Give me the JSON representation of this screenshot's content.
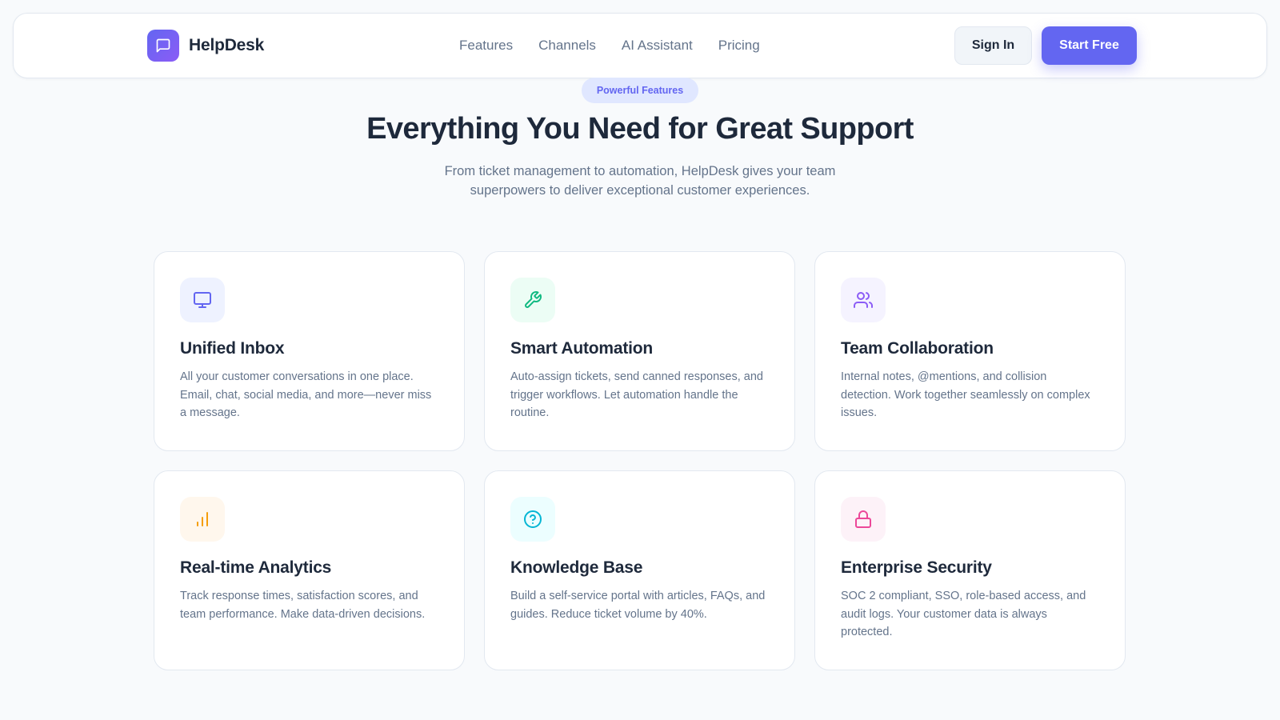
{
  "brand": {
    "name": "HelpDesk",
    "icon": "chat-bubble-icon",
    "accent": "#6366f1"
  },
  "nav": {
    "links": [
      "Features",
      "Channels",
      "AI Assistant",
      "Pricing"
    ],
    "sign_in": "Sign In",
    "start_free": "Start Free"
  },
  "hero": {
    "badge": "Powerful Features",
    "title": "Everything You Need for Great Support",
    "subtitle_line1": "From ticket management to automation, HelpDesk gives your team",
    "subtitle_line2": "superpowers to deliver exceptional customer experiences."
  },
  "features": [
    {
      "icon": "monitor-icon",
      "icon_color": "#6366f1",
      "icon_bg": "#eef2ff",
      "title": "Unified Inbox",
      "description": "All your customer conversations in one place. Email, chat, social media, and more—never miss a message."
    },
    {
      "icon": "wrench-icon",
      "icon_color": "#10b981",
      "icon_bg": "#ecfdf5",
      "title": "Smart Automation",
      "description": "Auto-assign tickets, send canned responses, and trigger workflows. Let automation handle the routine."
    },
    {
      "icon": "users-icon",
      "icon_color": "#8b5cf6",
      "icon_bg": "#f5f3ff",
      "title": "Team Collaboration",
      "description": "Internal notes, @mentions, and collision detection. Work together seamlessly on complex issues."
    },
    {
      "icon": "bar-chart-icon",
      "icon_color": "#f59e0b",
      "icon_bg": "#fff7ed",
      "title": "Real-time Analytics",
      "description": "Track response times, satisfaction scores, and team performance. Make data-driven decisions."
    },
    {
      "icon": "help-circle-icon",
      "icon_color": "#06b6d4",
      "icon_bg": "#ecfeff",
      "title": "Knowledge Base",
      "description": "Build a self-service portal with articles, FAQs, and guides. Reduce ticket volume by 40%."
    },
    {
      "icon": "lock-icon",
      "icon_color": "#ec4899",
      "icon_bg": "#fdf2f8",
      "title": "Enterprise Security",
      "description": "SOC 2 compliant, SSO, role-based access, and audit logs. Your customer data is always protected."
    }
  ]
}
